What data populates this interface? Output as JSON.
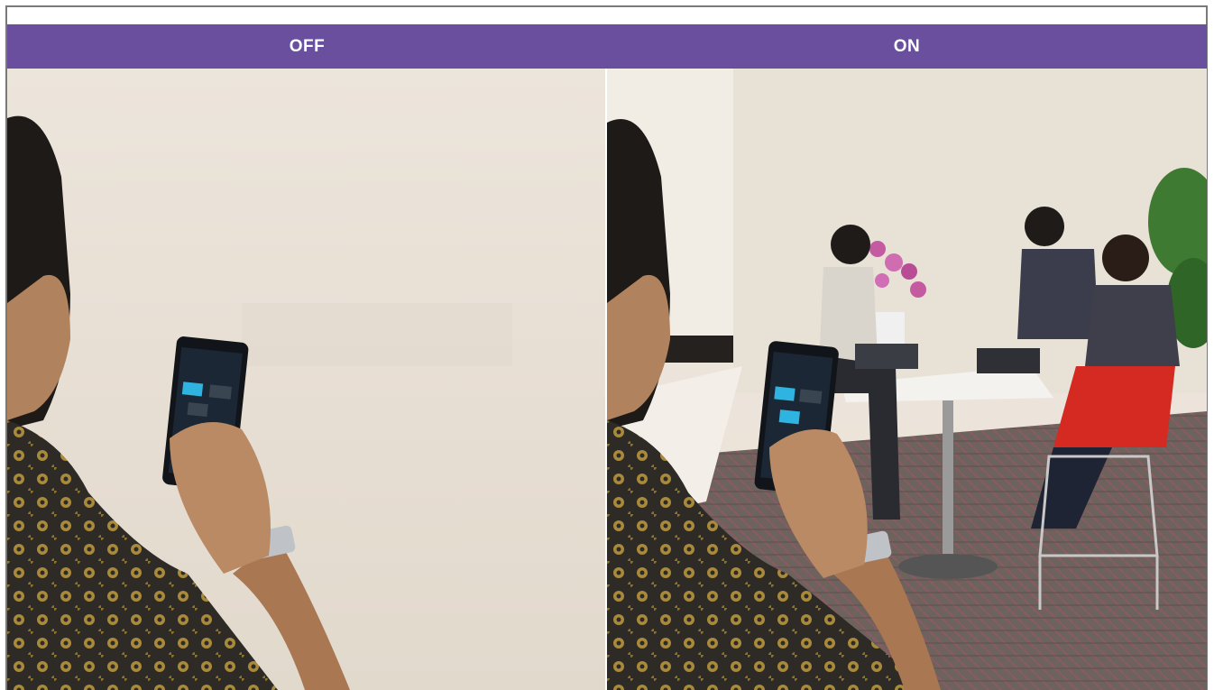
{
  "header": {
    "off_label": "OFF",
    "on_label": "ON"
  },
  "colors": {
    "header_bg": "#6a4f9f",
    "header_text": "#ffffff",
    "frame_border": "#7a7a7a"
  },
  "panels": [
    {
      "state": "off",
      "content": "man-holding-phone-opaque-glass"
    },
    {
      "state": "on",
      "content": "man-holding-phone-clear-glass-meeting-room"
    }
  ]
}
